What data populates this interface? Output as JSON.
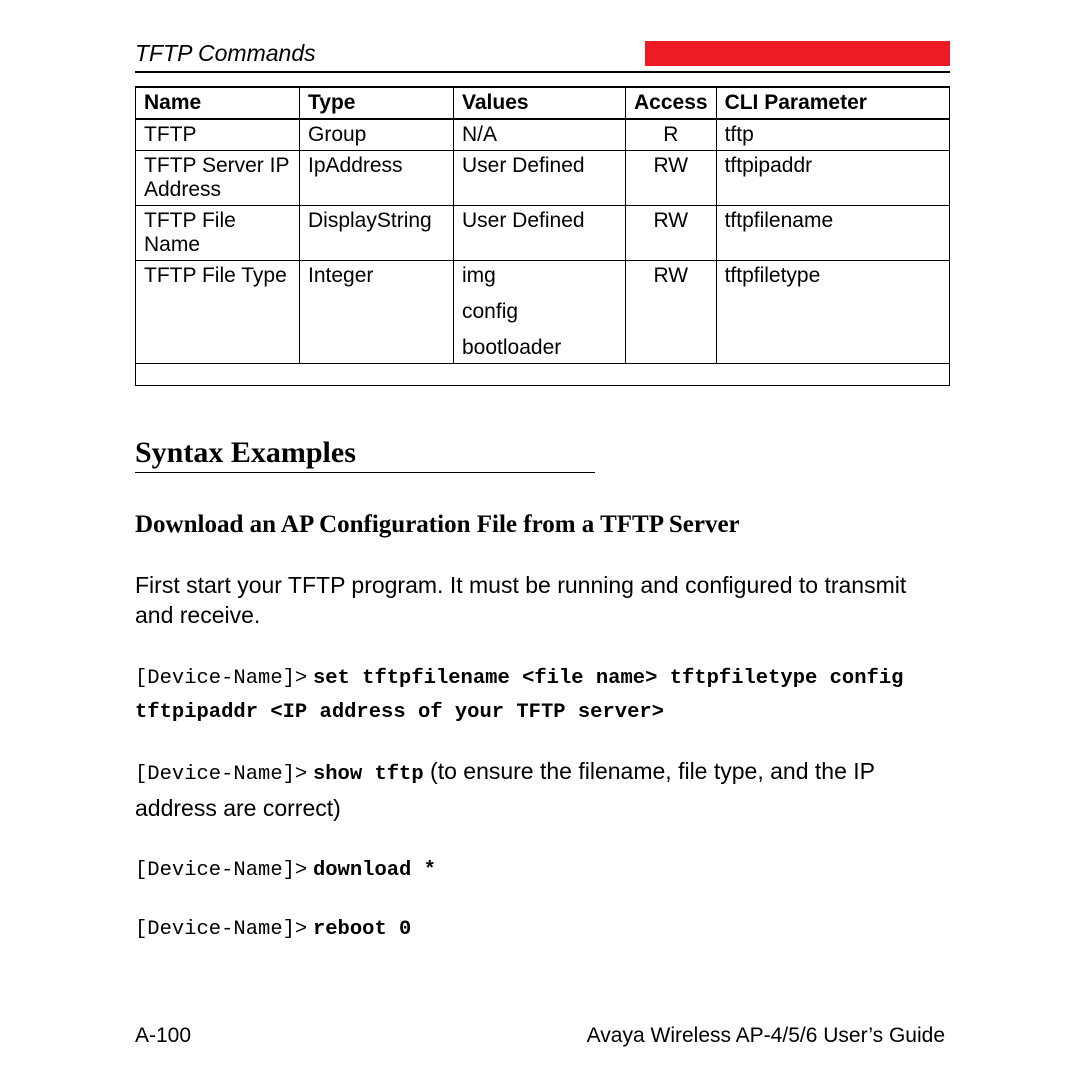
{
  "header": {
    "title": "TFTP Commands"
  },
  "table": {
    "headers": [
      "Name",
      "Type",
      "Values",
      "Access",
      "CLI Parameter"
    ],
    "rows": [
      {
        "name": "TFTP",
        "type": "Group",
        "values": "N/A",
        "access": "R",
        "cli": "tftp"
      },
      {
        "name": "TFTP Server IP Address",
        "type": "IpAddress",
        "values": "User Defined",
        "access": "RW",
        "cli": "tftpipaddr"
      },
      {
        "name": "TFTP File Name",
        "type": "DisplayString",
        "values": "User Defined",
        "access": "RW",
        "cli": "tftpfilename"
      },
      {
        "name": "TFTP File Type",
        "type": "Integer",
        "values_multi": [
          "img",
          "config",
          "bootloader"
        ],
        "access": "RW",
        "cli": "tftpfiletype"
      }
    ]
  },
  "syntax": {
    "heading": "Syntax Examples",
    "sub": "Download an AP Configuration File from a TFTP Server",
    "intro": "First start your TFTP program. It must be running and configured to transmit and receive.",
    "prompt": "[Device-Name]>",
    "cmd1_a": "set tftpfilename <file name> tftpfiletype config",
    "cmd1_b": "tftpipaddr <IP address of your TFTP server>",
    "cmd2": "show tftp",
    "cmd2_tail": " (to ensure the filename, file type, and the IP address are correct)",
    "cmd3": "download *",
    "cmd4": "reboot 0"
  },
  "footer": {
    "page": "A-100",
    "guide": "Avaya Wireless AP-4/5/6 User’s Guide"
  }
}
